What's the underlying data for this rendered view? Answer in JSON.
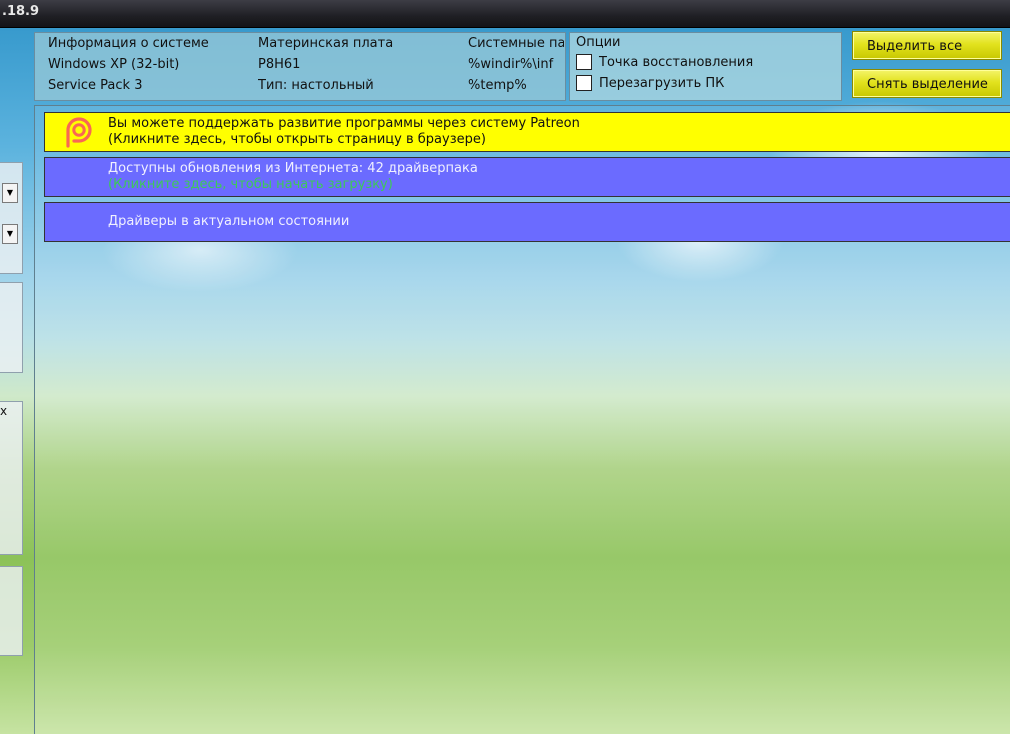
{
  "window": {
    "version": ".18.9"
  },
  "left_panel": {
    "text": "x"
  },
  "system_info": {
    "col1": [
      "Информация о системе",
      "Windows XP (32-bit)",
      "Service Pack 3"
    ],
    "col2": [
      "Материнская плата",
      "P8H61",
      "Тип: настольный"
    ],
    "col3": [
      "Системные па",
      "%windir%\\inf",
      "%temp%"
    ]
  },
  "options": {
    "title": "Опции",
    "restore_point": "Точка восстановления",
    "reboot": "Перезагрузить ПК"
  },
  "buttons": {
    "select_all": "Выделить все",
    "deselect": "Снять выделение"
  },
  "banners": {
    "patreon": {
      "line1": "Вы можете поддержать развитие программы через систему Patreon",
      "line2": "(Кликните здесь, чтобы открыть страницу в браузере)",
      "icon": "patreon-icon",
      "icon_color": "#f96854"
    },
    "updates": {
      "line1": "Доступны обновления из Интернета: 42 драйверпака",
      "line2": "(Кликните здесь, чтобы начать загрузку)"
    },
    "up_to_date": {
      "line1": "Драйверы в актуальном состоянии"
    }
  },
  "colors": {
    "banner_yellow": "#ffff00",
    "banner_blue": "#6b6bff",
    "link_green": "#3ec85a",
    "button_yellow": "#e2e21e"
  }
}
